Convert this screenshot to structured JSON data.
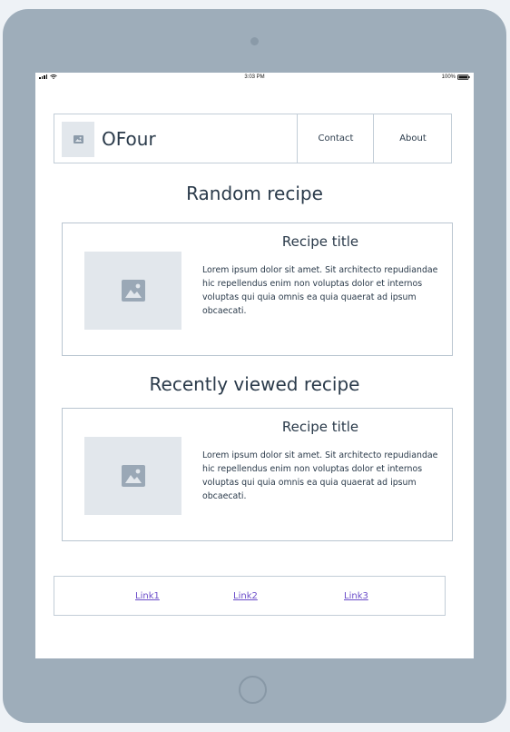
{
  "status_bar": {
    "time": "3:03 PM",
    "battery": "100%"
  },
  "header": {
    "brand": "OFour",
    "nav": [
      {
        "label": "Contact"
      },
      {
        "label": "About"
      }
    ]
  },
  "random_section": {
    "title": "Random recipe",
    "card": {
      "title": "Recipe title",
      "text": "Lorem ipsum dolor sit amet. Sit architecto repudiandae hic repellendus enim non voluptas dolor et internos voluptas qui quia omnis ea quia quaerat ad ipsum obcaecati."
    }
  },
  "recent_section": {
    "title": "Recently viewed recipe",
    "card": {
      "title": "Recipe title",
      "text": "Lorem ipsum dolor sit amet. Sit architecto repudiandae hic repellendus enim non voluptas dolor et internos voluptas qui quia omnis ea quia quaerat ad ipsum obcaecati."
    }
  },
  "footer": {
    "links": [
      {
        "label": "Link1"
      },
      {
        "label": "Link2"
      },
      {
        "label": "Link3"
      }
    ]
  },
  "colors": {
    "frame": "#9eadba",
    "link": "#6a4cc9",
    "placeholder": "#e2e7ec",
    "border": "#c2cdd7"
  },
  "icons": {
    "logo": "image-icon",
    "card_image": "image-icon"
  }
}
